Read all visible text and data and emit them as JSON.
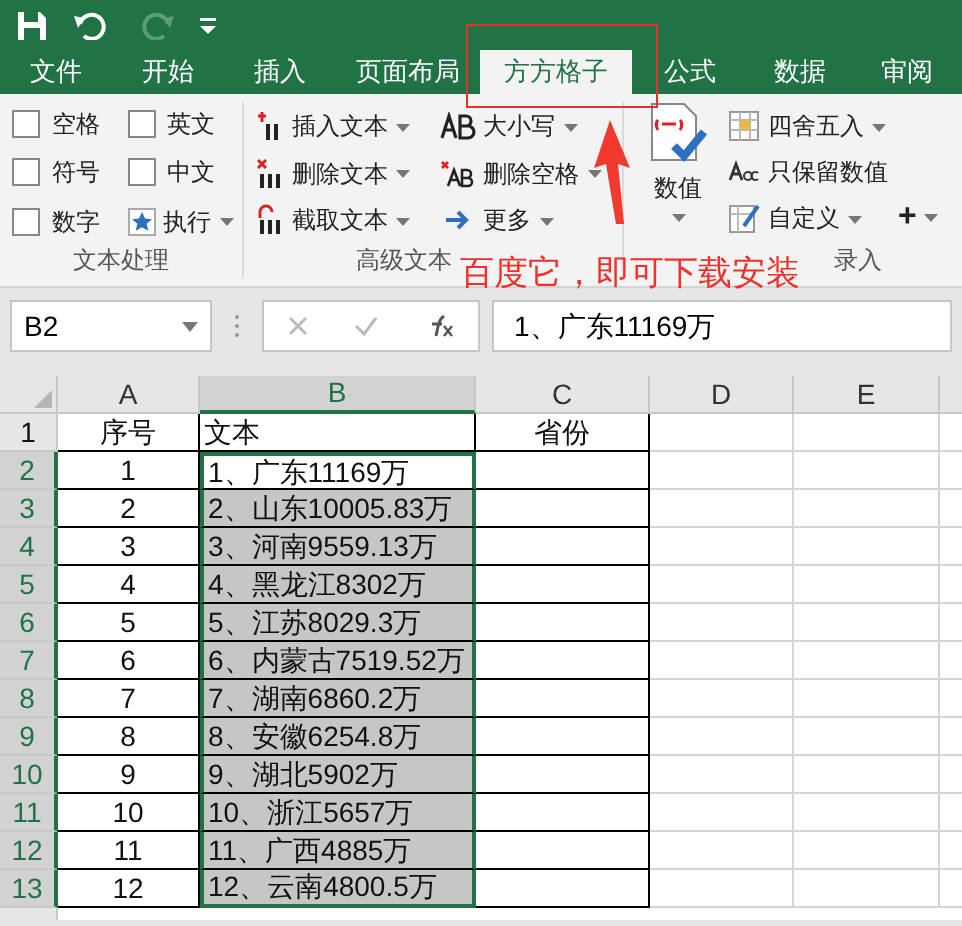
{
  "tabs": [
    {
      "label": "文件",
      "selected": false
    },
    {
      "label": "开始",
      "selected": false
    },
    {
      "label": "插入",
      "selected": false
    },
    {
      "label": "页面布局",
      "selected": false
    },
    {
      "label": "方方格子",
      "selected": true
    },
    {
      "label": "公式",
      "selected": false
    },
    {
      "label": "数据",
      "selected": false
    },
    {
      "label": "审阅",
      "selected": false
    }
  ],
  "ribbon": {
    "checkboxes": [
      {
        "label": "空格",
        "checked": false
      },
      {
        "label": "英文",
        "checked": false
      },
      {
        "label": "符号",
        "checked": false
      },
      {
        "label": "中文",
        "checked": false
      },
      {
        "label": "数字",
        "checked": false
      }
    ],
    "run_button": {
      "label": "执行"
    },
    "group_1_label": "文本处理",
    "text_commands": [
      {
        "label": "插入文本",
        "kind": "insert"
      },
      {
        "label": "删除文本",
        "kind": "delete"
      },
      {
        "label": "截取文本",
        "kind": "cut"
      },
      {
        "label": "大小写",
        "kind": "case"
      },
      {
        "label": "删除空格",
        "kind": "space"
      },
      {
        "label": "更多",
        "kind": "more"
      }
    ],
    "group_2_label": "高级文本",
    "value_button": {
      "label": "数值"
    },
    "value_commands": [
      {
        "label": "四舍五入",
        "kind": "round",
        "dropdown": true
      },
      {
        "label": "只保留数值",
        "kind": "keep",
        "dropdown": false
      },
      {
        "label": "自定义",
        "kind": "custom",
        "dropdown": true
      }
    ],
    "add_button": {
      "label": "+"
    },
    "group_3_label": "录入"
  },
  "name_box": "B2",
  "formula": "1、广东11169万",
  "columns": [
    {
      "label": "A",
      "selected": false
    },
    {
      "label": "B",
      "selected": true
    },
    {
      "label": "C",
      "selected": false
    },
    {
      "label": "D",
      "selected": false
    },
    {
      "label": "E",
      "selected": false
    }
  ],
  "rows": [
    {
      "number": "1",
      "selected": false,
      "cells": [
        {
          "text": "序号"
        },
        {
          "text": "文本"
        },
        {
          "text": "省份"
        }
      ]
    },
    {
      "number": "2",
      "selected": true,
      "cells": [
        {
          "text": "1"
        },
        {
          "text": "1、广东11169万",
          "selected": true,
          "active": true
        }
      ]
    },
    {
      "number": "3",
      "selected": true,
      "cells": [
        {
          "text": "2"
        },
        {
          "text": "2、山东10005.83万",
          "selected": true,
          "active": false
        }
      ]
    },
    {
      "number": "4",
      "selected": true,
      "cells": [
        {
          "text": "3"
        },
        {
          "text": "3、河南9559.13万",
          "selected": true,
          "active": false
        }
      ]
    },
    {
      "number": "5",
      "selected": true,
      "cells": [
        {
          "text": "4"
        },
        {
          "text": "4、黑龙江8302万",
          "selected": true,
          "active": false
        }
      ]
    },
    {
      "number": "6",
      "selected": true,
      "cells": [
        {
          "text": "5"
        },
        {
          "text": "5、江苏8029.3万",
          "selected": true,
          "active": false
        }
      ]
    },
    {
      "number": "7",
      "selected": true,
      "cells": [
        {
          "text": "6"
        },
        {
          "text": "6、内蒙古7519.52万",
          "selected": true,
          "active": false
        }
      ]
    },
    {
      "number": "8",
      "selected": true,
      "cells": [
        {
          "text": "7"
        },
        {
          "text": "7、湖南6860.2万",
          "selected": true,
          "active": false
        }
      ]
    },
    {
      "number": "9",
      "selected": true,
      "cells": [
        {
          "text": "8"
        },
        {
          "text": "8、安徽6254.8万",
          "selected": true,
          "active": false
        }
      ]
    },
    {
      "number": "10",
      "selected": true,
      "cells": [
        {
          "text": "9"
        },
        {
          "text": "9、湖北5902万",
          "selected": true,
          "active": false
        }
      ]
    },
    {
      "number": "11",
      "selected": true,
      "cells": [
        {
          "text": "10"
        },
        {
          "text": "10、浙江5657万",
          "selected": true,
          "active": false
        }
      ]
    },
    {
      "number": "12",
      "selected": true,
      "cells": [
        {
          "text": "11"
        },
        {
          "text": "11、广西4885万",
          "selected": true,
          "active": false
        }
      ]
    },
    {
      "number": "13",
      "selected": true,
      "cells": [
        {
          "text": "12"
        },
        {
          "text": "12、云南4800.5万",
          "selected": true,
          "active": false
        }
      ]
    }
  ],
  "annotation": {
    "text": "百度它，即可下载安装"
  }
}
